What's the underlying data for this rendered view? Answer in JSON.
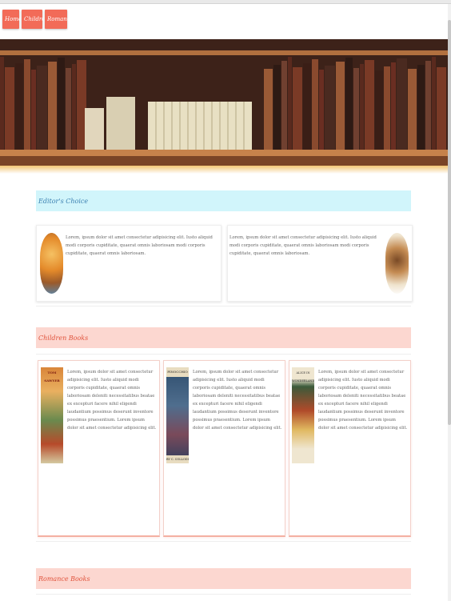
{
  "nav": {
    "home": "Home",
    "children": "Children",
    "romance": "Romance"
  },
  "sections": {
    "editors": "Editor's Choice",
    "children": "Children Books",
    "romance": "Romance Books"
  },
  "editors_cards": [
    {
      "text": "Lorem, ipsum dolor sit amet consectetur adipisicing elit. Iusto aliquid modi corporis cupiditate, quaerat omnis laboriosam modi corporis cupiditate, quaerat omnis laboriosam."
    },
    {
      "text": "Lorem, ipsum dolor sit amet consectetur adipisicing elit. Iusto aliquid modi corporis cupiditate, quaerat omnis laboriosam modi corporis cupiditate, quaerat omnis laboriosam."
    }
  ],
  "children_cards": [
    {
      "text": "Lorem, ipsum dolor sit amet consectetur adipisicing elit. Iusto aliquid modi corporis cupiditate, quaerat omnis laboriosam deleniti necessitatibus beatae ex excepturi facere nihil eligendi laudantium possimus deserunt inventore possimus praesentium. Lorem ipsum dolor sit amet consectetur adipisicing elit."
    },
    {
      "text": "Lorem, ipsum dolor sit amet consectetur adipisicing elit. Iusto aliquid modi corporis cupiditate, quaerat omnis laboriosam deleniti necessitatibus beatae ex excepturi facere nihil eligendi laudantium possimus deserunt inventore possimus praesentium. Lorem ipsum dolor sit amet consectetur adipisicing elit."
    },
    {
      "text": "Lorem, ipsum dolor sit amet consectetur adipisicing elit. Iusto aliquid modi corporis cupiditate, quaerat omnis laboriosam deleniti necessitatibus beatae ex excepturi facere nihil eligendi laudantium possimus deserunt inventore possimus praesentium. Lorem ipsum dolor sit amet consectetur adipisicing elit."
    }
  ],
  "book_covers": {
    "pinocchio_title": "PINOCCHIO",
    "pinocchio_author": "BY C. COLLODI",
    "third_title": "ALICE IN WONDERLAND",
    "first_title": "TOM SAWYER"
  },
  "colors": {
    "nav": "#f26b58",
    "blue_bar": "#d1f5fb",
    "pink_bar": "#fcd7d0"
  }
}
